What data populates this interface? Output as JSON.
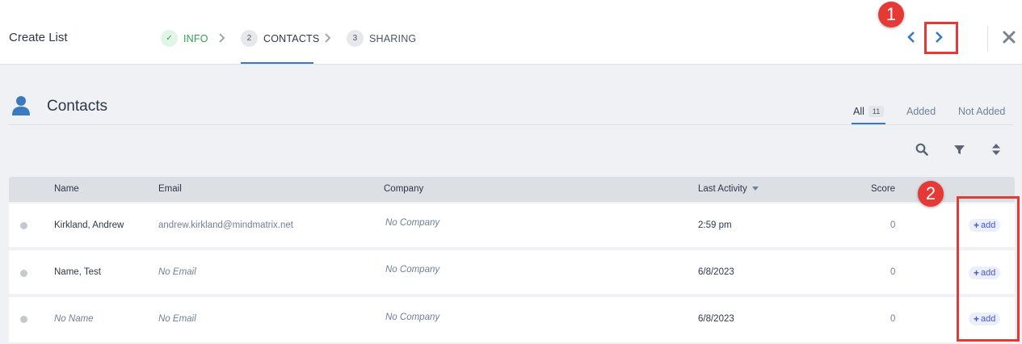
{
  "header": {
    "title": "Create List",
    "steps": [
      {
        "num": "✓",
        "label": "INFO",
        "state": "done"
      },
      {
        "num": "2",
        "label": "CONTACTS",
        "state": "active"
      },
      {
        "num": "3",
        "label": "SHARING",
        "state": "pending"
      }
    ],
    "prev_icon": "chevron-left-icon",
    "next_icon": "chevron-right-icon",
    "close_icon": "close-icon"
  },
  "annotations": {
    "badge1": "1",
    "badge2": "2",
    "color": "#e53935"
  },
  "section": {
    "title": "Contacts",
    "icon": "person-icon",
    "filters": {
      "all_label": "All",
      "all_count": "11",
      "added_label": "Added",
      "not_added_label": "Not Added"
    },
    "tools": [
      "search-icon",
      "filter-icon",
      "sort-icon"
    ]
  },
  "table": {
    "columns": {
      "name": "Name",
      "email": "Email",
      "company": "Company",
      "last_activity": "Last Activity",
      "score": "Score"
    },
    "rows": [
      {
        "name": "Kirkland, Andrew",
        "email": "andrew.kirkland@mindmatrix.net",
        "company": "No Company",
        "last_activity": "2:59 pm",
        "score": "0",
        "action": "add"
      },
      {
        "name": "Name, Test",
        "email": "No Email",
        "company": "No Company",
        "last_activity": "6/8/2023",
        "score": "0",
        "action": "add"
      },
      {
        "name": "No Name",
        "email": "No Email",
        "company": "No Company",
        "last_activity": "6/8/2023",
        "score": "0",
        "action": "add"
      }
    ]
  },
  "colors": {
    "accent": "#3a7bbf",
    "done_green": "#2ea055",
    "add_button": "#4657c9"
  }
}
